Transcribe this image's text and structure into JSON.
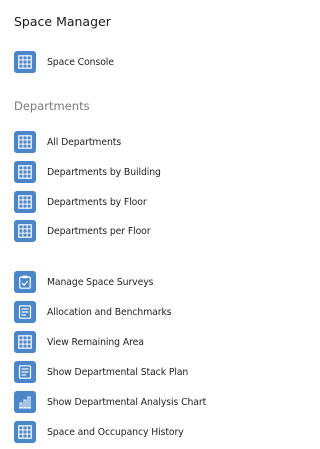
{
  "header": {
    "title": "Space Manager"
  },
  "top_item": {
    "label": "Space Console",
    "icon": "grid-icon"
  },
  "departments": {
    "section_label": "Departments",
    "items": [
      {
        "label": "All Departments",
        "icon": "grid-icon"
      },
      {
        "label": "Departments by Building",
        "icon": "grid-icon"
      },
      {
        "label": "Departments by Floor",
        "icon": "grid-icon"
      },
      {
        "label": "Departments per Floor",
        "icon": "grid-icon"
      }
    ]
  },
  "tasks": {
    "items": [
      {
        "label": "Manage Space Surveys",
        "icon": "clipboard-check-icon"
      },
      {
        "label": "Allocation and Benchmarks",
        "icon": "report-icon"
      },
      {
        "label": "View Remaining Area",
        "icon": "grid-icon"
      },
      {
        "label": "Show Departmental Stack Plan",
        "icon": "report-icon"
      },
      {
        "label": "Show Departmental Analysis Chart",
        "icon": "bar-chart-icon"
      },
      {
        "label": "Space and Occupancy History",
        "icon": "grid-icon"
      }
    ]
  },
  "colors": {
    "icon_bg": "#4a86c8",
    "icon_fg": "#ffffff",
    "text": "#1f1f1f",
    "muted": "#7a7a7a"
  }
}
